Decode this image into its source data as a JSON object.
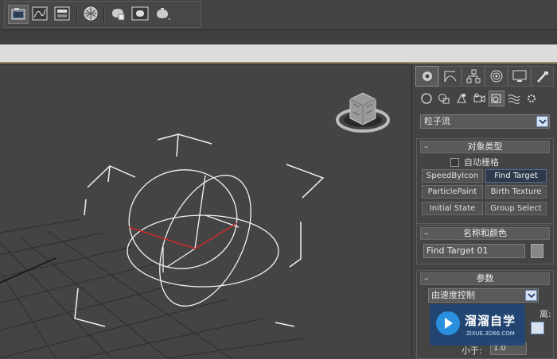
{
  "toolbar": {
    "icons": [
      "render-setup-icon",
      "curve-editor-icon",
      "schematic-view-icon",
      "material-editor-icon",
      "render-teapot-icon",
      "rendered-frame-icon",
      "render-production-icon"
    ]
  },
  "viewport": {
    "icons": [
      "viewcube-icon"
    ]
  },
  "command_panel": {
    "tabs": [
      "create-tab",
      "modify-tab",
      "hierarchy-tab",
      "motion-tab",
      "display-tab",
      "utilities-tab"
    ],
    "categories": [
      "geometry-icon",
      "shapes-icon",
      "lights-icon",
      "cameras-icon",
      "helpers-icon",
      "space-warps-icon",
      "systems-icon"
    ],
    "subcategory": "粒子流",
    "object_type": {
      "title": "对象类型",
      "autogrid_label": "自动栅格",
      "buttons": [
        "SpeedByIcon",
        "Find Target",
        "ParticlePaint",
        "Birth Texture",
        "Initial State",
        "Group Select"
      ]
    },
    "name_color": {
      "title": "名称和颜色",
      "name_value": "Find Target 01"
    },
    "parameters": {
      "title": "参数",
      "mode_value": "由速度控制",
      "partial_label": "离:",
      "partial_label2": "小于:",
      "partial_value": "1.0"
    }
  },
  "watermark": {
    "title": "溜溜自学",
    "url": "ZIXUE.3D66.COM"
  },
  "colors": {
    "selection": "#2e3a4c",
    "axis_red": "#cc2a2a",
    "watermark_bg": "#1e4678"
  }
}
